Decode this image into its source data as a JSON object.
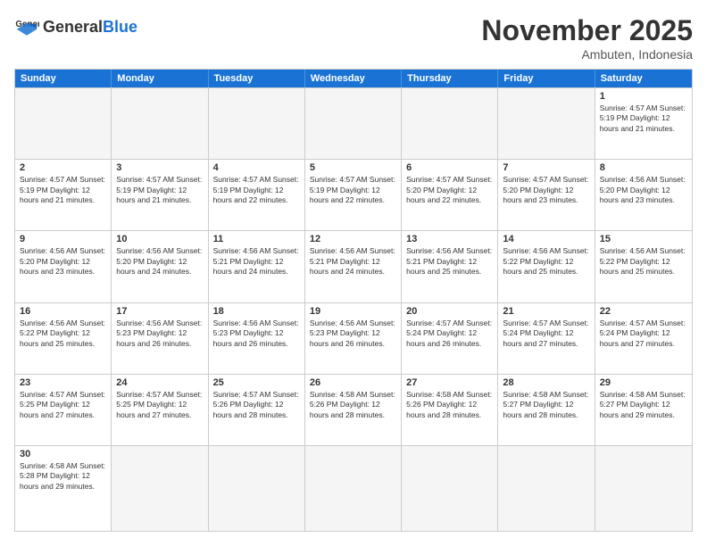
{
  "header": {
    "logo_general": "General",
    "logo_blue": "Blue",
    "month_title": "November 2025",
    "location": "Ambuten, Indonesia"
  },
  "weekdays": [
    "Sunday",
    "Monday",
    "Tuesday",
    "Wednesday",
    "Thursday",
    "Friday",
    "Saturday"
  ],
  "rows": [
    [
      {
        "day": "",
        "info": "",
        "empty": true
      },
      {
        "day": "",
        "info": "",
        "empty": true
      },
      {
        "day": "",
        "info": "",
        "empty": true
      },
      {
        "day": "",
        "info": "",
        "empty": true
      },
      {
        "day": "",
        "info": "",
        "empty": true
      },
      {
        "day": "",
        "info": "",
        "empty": true
      },
      {
        "day": "1",
        "info": "Sunrise: 4:57 AM\nSunset: 5:19 PM\nDaylight: 12 hours\nand 21 minutes.",
        "empty": false
      }
    ],
    [
      {
        "day": "2",
        "info": "Sunrise: 4:57 AM\nSunset: 5:19 PM\nDaylight: 12 hours\nand 21 minutes.",
        "empty": false
      },
      {
        "day": "3",
        "info": "Sunrise: 4:57 AM\nSunset: 5:19 PM\nDaylight: 12 hours\nand 21 minutes.",
        "empty": false
      },
      {
        "day": "4",
        "info": "Sunrise: 4:57 AM\nSunset: 5:19 PM\nDaylight: 12 hours\nand 22 minutes.",
        "empty": false
      },
      {
        "day": "5",
        "info": "Sunrise: 4:57 AM\nSunset: 5:19 PM\nDaylight: 12 hours\nand 22 minutes.",
        "empty": false
      },
      {
        "day": "6",
        "info": "Sunrise: 4:57 AM\nSunset: 5:20 PM\nDaylight: 12 hours\nand 22 minutes.",
        "empty": false
      },
      {
        "day": "7",
        "info": "Sunrise: 4:57 AM\nSunset: 5:20 PM\nDaylight: 12 hours\nand 23 minutes.",
        "empty": false
      },
      {
        "day": "8",
        "info": "Sunrise: 4:56 AM\nSunset: 5:20 PM\nDaylight: 12 hours\nand 23 minutes.",
        "empty": false
      }
    ],
    [
      {
        "day": "9",
        "info": "Sunrise: 4:56 AM\nSunset: 5:20 PM\nDaylight: 12 hours\nand 23 minutes.",
        "empty": false
      },
      {
        "day": "10",
        "info": "Sunrise: 4:56 AM\nSunset: 5:20 PM\nDaylight: 12 hours\nand 24 minutes.",
        "empty": false
      },
      {
        "day": "11",
        "info": "Sunrise: 4:56 AM\nSunset: 5:21 PM\nDaylight: 12 hours\nand 24 minutes.",
        "empty": false
      },
      {
        "day": "12",
        "info": "Sunrise: 4:56 AM\nSunset: 5:21 PM\nDaylight: 12 hours\nand 24 minutes.",
        "empty": false
      },
      {
        "day": "13",
        "info": "Sunrise: 4:56 AM\nSunset: 5:21 PM\nDaylight: 12 hours\nand 25 minutes.",
        "empty": false
      },
      {
        "day": "14",
        "info": "Sunrise: 4:56 AM\nSunset: 5:22 PM\nDaylight: 12 hours\nand 25 minutes.",
        "empty": false
      },
      {
        "day": "15",
        "info": "Sunrise: 4:56 AM\nSunset: 5:22 PM\nDaylight: 12 hours\nand 25 minutes.",
        "empty": false
      }
    ],
    [
      {
        "day": "16",
        "info": "Sunrise: 4:56 AM\nSunset: 5:22 PM\nDaylight: 12 hours\nand 25 minutes.",
        "empty": false
      },
      {
        "day": "17",
        "info": "Sunrise: 4:56 AM\nSunset: 5:23 PM\nDaylight: 12 hours\nand 26 minutes.",
        "empty": false
      },
      {
        "day": "18",
        "info": "Sunrise: 4:56 AM\nSunset: 5:23 PM\nDaylight: 12 hours\nand 26 minutes.",
        "empty": false
      },
      {
        "day": "19",
        "info": "Sunrise: 4:56 AM\nSunset: 5:23 PM\nDaylight: 12 hours\nand 26 minutes.",
        "empty": false
      },
      {
        "day": "20",
        "info": "Sunrise: 4:57 AM\nSunset: 5:24 PM\nDaylight: 12 hours\nand 26 minutes.",
        "empty": false
      },
      {
        "day": "21",
        "info": "Sunrise: 4:57 AM\nSunset: 5:24 PM\nDaylight: 12 hours\nand 27 minutes.",
        "empty": false
      },
      {
        "day": "22",
        "info": "Sunrise: 4:57 AM\nSunset: 5:24 PM\nDaylight: 12 hours\nand 27 minutes.",
        "empty": false
      }
    ],
    [
      {
        "day": "23",
        "info": "Sunrise: 4:57 AM\nSunset: 5:25 PM\nDaylight: 12 hours\nand 27 minutes.",
        "empty": false
      },
      {
        "day": "24",
        "info": "Sunrise: 4:57 AM\nSunset: 5:25 PM\nDaylight: 12 hours\nand 27 minutes.",
        "empty": false
      },
      {
        "day": "25",
        "info": "Sunrise: 4:57 AM\nSunset: 5:26 PM\nDaylight: 12 hours\nand 28 minutes.",
        "empty": false
      },
      {
        "day": "26",
        "info": "Sunrise: 4:58 AM\nSunset: 5:26 PM\nDaylight: 12 hours\nand 28 minutes.",
        "empty": false
      },
      {
        "day": "27",
        "info": "Sunrise: 4:58 AM\nSunset: 5:26 PM\nDaylight: 12 hours\nand 28 minutes.",
        "empty": false
      },
      {
        "day": "28",
        "info": "Sunrise: 4:58 AM\nSunset: 5:27 PM\nDaylight: 12 hours\nand 28 minutes.",
        "empty": false
      },
      {
        "day": "29",
        "info": "Sunrise: 4:58 AM\nSunset: 5:27 PM\nDaylight: 12 hours\nand 29 minutes.",
        "empty": false
      }
    ],
    [
      {
        "day": "30",
        "info": "Sunrise: 4:58 AM\nSunset: 5:28 PM\nDaylight: 12 hours\nand 29 minutes.",
        "empty": false
      },
      {
        "day": "",
        "info": "",
        "empty": true
      },
      {
        "day": "",
        "info": "",
        "empty": true
      },
      {
        "day": "",
        "info": "",
        "empty": true
      },
      {
        "day": "",
        "info": "",
        "empty": true
      },
      {
        "day": "",
        "info": "",
        "empty": true
      },
      {
        "day": "",
        "info": "",
        "empty": true
      }
    ]
  ]
}
